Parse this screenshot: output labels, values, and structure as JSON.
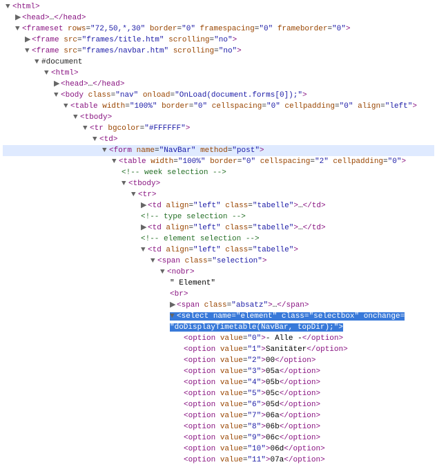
{
  "arrows": {
    "down": "▼",
    "right": "▶"
  },
  "ellipsis": "…",
  "doc_label": "#document",
  "text_element_label": "\" Element\"",
  "tags": {
    "html": "html",
    "head": "head",
    "frameset": "frameset",
    "frame": "frame",
    "body": "body",
    "table": "table",
    "tbody": "tbody",
    "tr": "tr",
    "td": "td",
    "form": "form",
    "span": "span",
    "nobr": "nobr",
    "br": "br",
    "select": "select",
    "option": "option"
  },
  "attrs": {
    "rows": "rows",
    "border": "border",
    "framespacing": "framespacing",
    "frameborder": "frameborder",
    "src": "src",
    "scrolling": "scrolling",
    "class": "class",
    "onload": "onload",
    "width": "width",
    "cellspacing": "cellspacing",
    "cellpadding": "cellpadding",
    "align": "align",
    "bgcolor": "bgcolor",
    "name": "name",
    "method": "method",
    "onchange": "onchange",
    "value": "value"
  },
  "vals": {
    "frameset_rows": "72,50,*,30",
    "zero": "0",
    "title_src": "frames/title.htm",
    "navbar_src": "frames/navbar.htm",
    "no": "no",
    "nav": "nav",
    "onload_js": "OnLoad(document.forms[0]);",
    "width100": "100%",
    "cellspacing0": "0",
    "cellpadding0": "0",
    "left": "left",
    "bgcolor_white": "#FFFFFF",
    "form_name": "NavBar",
    "post": "post",
    "cellspacing2": "2",
    "tabelle": "tabelle",
    "selection": "selection",
    "absatz": "absatz",
    "select_name": "element",
    "selectbox": "selectbox",
    "onchange_js": "doDisplayTimetable(NavBar, topDir);"
  },
  "comments": {
    "week": "<!-- week selection -->",
    "type": "<!-- type selection -->",
    "element": "<!-- element selection -->"
  },
  "options": [
    {
      "value": "0",
      "text": "- Alle -"
    },
    {
      "value": "1",
      "text": "Sanitäter"
    },
    {
      "value": "2",
      "text": "00"
    },
    {
      "value": "3",
      "text": "05a"
    },
    {
      "value": "4",
      "text": "05b"
    },
    {
      "value": "5",
      "text": "05c"
    },
    {
      "value": "6",
      "text": "05d"
    },
    {
      "value": "7",
      "text": "06a"
    },
    {
      "value": "8",
      "text": "06b"
    },
    {
      "value": "9",
      "text": "06c"
    },
    {
      "value": "10",
      "text": "06d"
    },
    {
      "value": "11",
      "text": "07a"
    }
  ]
}
